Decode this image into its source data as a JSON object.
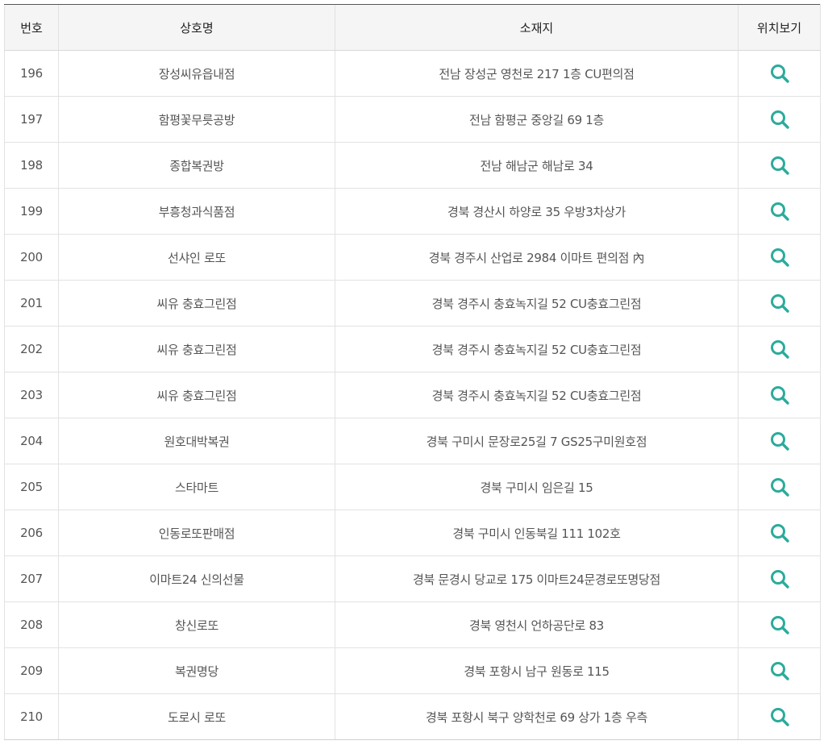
{
  "table": {
    "headers": {
      "number": "번호",
      "name": "상호명",
      "address": "소재지",
      "view": "위치보기"
    },
    "icon": "search-icon",
    "icon_color": "#2bab9c",
    "rows": [
      {
        "number": "196",
        "name": "장성씨유읍내점",
        "address": "전남 장성군 영천로 217 1층 CU편의점"
      },
      {
        "number": "197",
        "name": "함평꽃무릇공방",
        "address": "전남 함평군 중앙길 69 1층"
      },
      {
        "number": "198",
        "name": "종합복권방",
        "address": "전남 해남군 해남로 34"
      },
      {
        "number": "199",
        "name": "부흥청과식품점",
        "address": "경북 경산시 하양로 35 우방3차상가"
      },
      {
        "number": "200",
        "name": "선샤인 로또",
        "address": "경북 경주시 산업로 2984 이마트 편의점 內"
      },
      {
        "number": "201",
        "name": "씨유 충효그린점",
        "address": "경북 경주시 충효녹지길 52 CU충효그린점"
      },
      {
        "number": "202",
        "name": "씨유 충효그린점",
        "address": "경북 경주시 충효녹지길 52 CU충효그린점"
      },
      {
        "number": "203",
        "name": "씨유 충효그린점",
        "address": "경북 경주시 충효녹지길 52 CU충효그린점"
      },
      {
        "number": "204",
        "name": "원호대박복권",
        "address": "경북 구미시 문장로25길 7 GS25구미원호점"
      },
      {
        "number": "205",
        "name": "스타마트",
        "address": "경북 구미시 임은길 15"
      },
      {
        "number": "206",
        "name": "인동로또판매점",
        "address": "경북 구미시 인동북길 111 102호"
      },
      {
        "number": "207",
        "name": "이마트24 신의선물",
        "address": "경북 문경시 당교로 175 이마트24문경로또명당점"
      },
      {
        "number": "208",
        "name": "창신로또",
        "address": "경북 영천시 언하공단로 83"
      },
      {
        "number": "209",
        "name": "복권명당",
        "address": "경북 포항시 남구 원동로 115"
      },
      {
        "number": "210",
        "name": "도로시 로또",
        "address": "경북 포항시 북구 양학천로 69 상가 1층 우측"
      }
    ]
  }
}
